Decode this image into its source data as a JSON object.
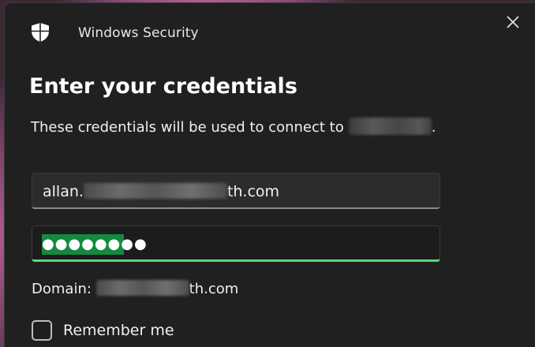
{
  "window": {
    "app_title": "Windows Security",
    "close_icon": "close-icon",
    "shield_icon": "shield-icon"
  },
  "main": {
    "heading": "Enter your credentials",
    "description_prefix": "These credentials will be used to connect to",
    "description_suffix": ".",
    "username_prefix": "allan.",
    "username_suffix": "th.com",
    "password_masked": "●●●●●●●●",
    "domain_label": "Domain:",
    "domain_suffix": "th.com",
    "remember_label": "Remember me",
    "remember_checked": false
  },
  "colors": {
    "dialog_bg": "#202020",
    "field_bg": "#2c2c2c",
    "focus_accent": "#5fd37a",
    "selection": "#138a3e"
  }
}
